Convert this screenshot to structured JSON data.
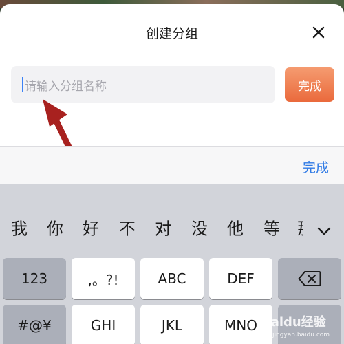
{
  "sheet": {
    "title": "创建分组",
    "input_placeholder": "请输入分组名称",
    "done_label": "完成"
  },
  "toolbar": {
    "done_label": "完成"
  },
  "keyboard": {
    "candidates": [
      "我",
      "你",
      "好",
      "不",
      "对",
      "没",
      "他",
      "等",
      "那"
    ],
    "keys": {
      "num": "123",
      "punct": ",。?!",
      "abc": "ABC",
      "def": "DEF",
      "sym": "#@¥",
      "ghi": "GHI",
      "jkl": "JKL",
      "mno": "MNO"
    }
  },
  "watermark": {
    "brand": "Baidu经验",
    "url": "jingyan.baidu.com"
  },
  "colors": {
    "accent_blue": "#2f7ae5",
    "done_button": "#ea6a3c",
    "arrow": "#a8211f",
    "keyboard_bg": "#d2d4da"
  },
  "icons": {
    "close": "close-icon",
    "backspace": "backspace-icon",
    "expand": "chevron-down-icon",
    "annotation": "red-arrow-icon"
  }
}
